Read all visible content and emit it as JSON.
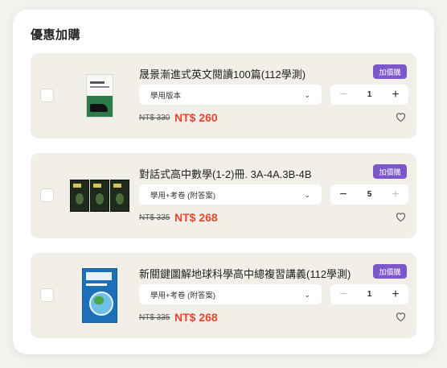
{
  "section_title": "優惠加購",
  "colors": {
    "accent": "#7c57c9",
    "price": "#e8452c",
    "card_bg": "#f2efe9"
  },
  "items": [
    {
      "title": "晟景漸進式英文閱讀100篇(112學測)",
      "badge": "加價購",
      "option": "學用版本",
      "quantity": "1",
      "old_price": "NT$ 330",
      "price": "NT$ 260"
    },
    {
      "title": "對話式高中數學(1-2)冊. 3A-4A.3B-4B",
      "badge": "加價購",
      "option": "學用+考卷 (附答案)",
      "quantity": "5",
      "old_price": "NT$ 335",
      "price": "NT$ 268"
    },
    {
      "title": "新關鍵圖解地球科學高中總複習講義(112學測)",
      "badge": "加價購",
      "option": "學用+考卷 (附答案)",
      "quantity": "1",
      "old_price": "NT$ 335",
      "price": "NT$ 268"
    }
  ],
  "icons": {
    "chevron": "chevron-down-icon",
    "heart": "heart-outline-icon",
    "minus": "minus-icon",
    "plus": "plus-icon"
  }
}
